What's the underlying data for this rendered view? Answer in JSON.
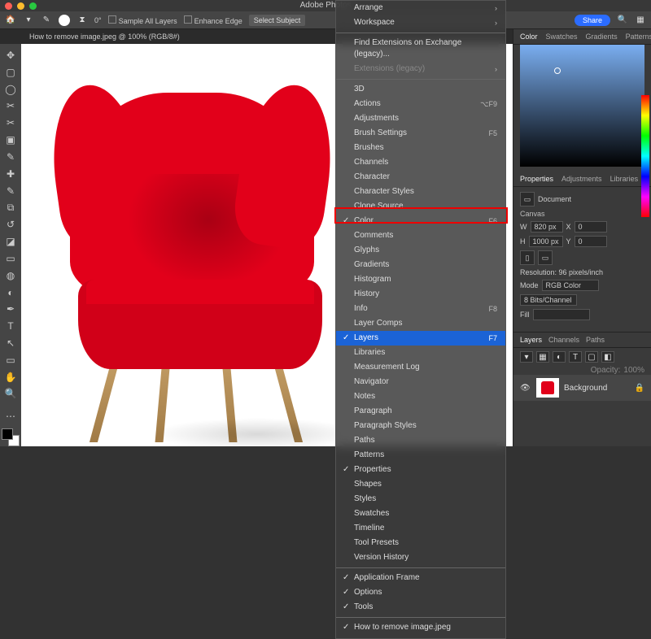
{
  "app": {
    "title": "Adobe Photos"
  },
  "optbar": {
    "angle": "0°",
    "sample_all": "Sample All Layers",
    "enhance_edge": "Enhance Edge",
    "select_subject": "Select Subject",
    "share": "Share"
  },
  "doc": {
    "tab_label": "How to remove image.jpeg @ 100% (RGB/8#)"
  },
  "menu": {
    "groups": [
      [
        {
          "label": "Arrange",
          "submenu": true
        },
        {
          "label": "Workspace",
          "submenu": true
        }
      ],
      [
        {
          "label": "Find Extensions on Exchange (legacy)..."
        },
        {
          "label": "Extensions (legacy)",
          "submenu": true,
          "disabled": true
        }
      ],
      [
        {
          "label": "3D"
        },
        {
          "label": "Actions",
          "shortcut": "⌥F9"
        },
        {
          "label": "Adjustments"
        },
        {
          "label": "Brush Settings",
          "shortcut": "F5"
        },
        {
          "label": "Brushes"
        },
        {
          "label": "Channels"
        },
        {
          "label": "Character"
        },
        {
          "label": "Character Styles"
        },
        {
          "label": "Clone Source"
        },
        {
          "label": "Color",
          "checked": true,
          "shortcut": "F6"
        },
        {
          "label": "Comments"
        },
        {
          "label": "Glyphs"
        },
        {
          "label": "Gradients"
        },
        {
          "label": "Histogram"
        },
        {
          "label": "History"
        },
        {
          "label": "Info",
          "shortcut": "F8"
        },
        {
          "label": "Layer Comps"
        },
        {
          "label": "Layers",
          "checked": true,
          "shortcut": "F7",
          "highlight": true
        },
        {
          "label": "Libraries"
        },
        {
          "label": "Measurement Log"
        },
        {
          "label": "Navigator"
        },
        {
          "label": "Notes"
        },
        {
          "label": "Paragraph"
        },
        {
          "label": "Paragraph Styles"
        },
        {
          "label": "Paths"
        },
        {
          "label": "Patterns"
        },
        {
          "label": "Properties",
          "checked": true
        },
        {
          "label": "Shapes"
        },
        {
          "label": "Styles"
        },
        {
          "label": "Swatches"
        },
        {
          "label": "Timeline"
        },
        {
          "label": "Tool Presets"
        },
        {
          "label": "Version History"
        }
      ],
      [
        {
          "label": "Application Frame",
          "checked": true
        },
        {
          "label": "Options",
          "checked": true
        },
        {
          "label": "Tools",
          "checked": true
        }
      ],
      [
        {
          "label": "How to remove image.jpeg",
          "checked": true
        }
      ]
    ]
  },
  "right": {
    "tabs": [
      "Color",
      "Swatches",
      "Gradients",
      "Patterns"
    ],
    "properties": {
      "tabs": [
        "Properties",
        "Adjustments",
        "Libraries"
      ],
      "doc_badge": "Document",
      "canvas_label": "Canvas",
      "w": "820 px",
      "x": "0",
      "h": "1000 px",
      "y": "0",
      "resolution": "Resolution: 96 pixels/inch",
      "mode_label": "Mode",
      "mode_value": "RGB Color",
      "bits_value": "8 Bits/Channel",
      "fill_label": "Fill"
    },
    "layers": {
      "tabs": [
        "Layers",
        "Channels",
        "Paths"
      ],
      "opacity_label": "Opacity:",
      "opacity_value": "100%",
      "layer_name": "Background"
    }
  }
}
